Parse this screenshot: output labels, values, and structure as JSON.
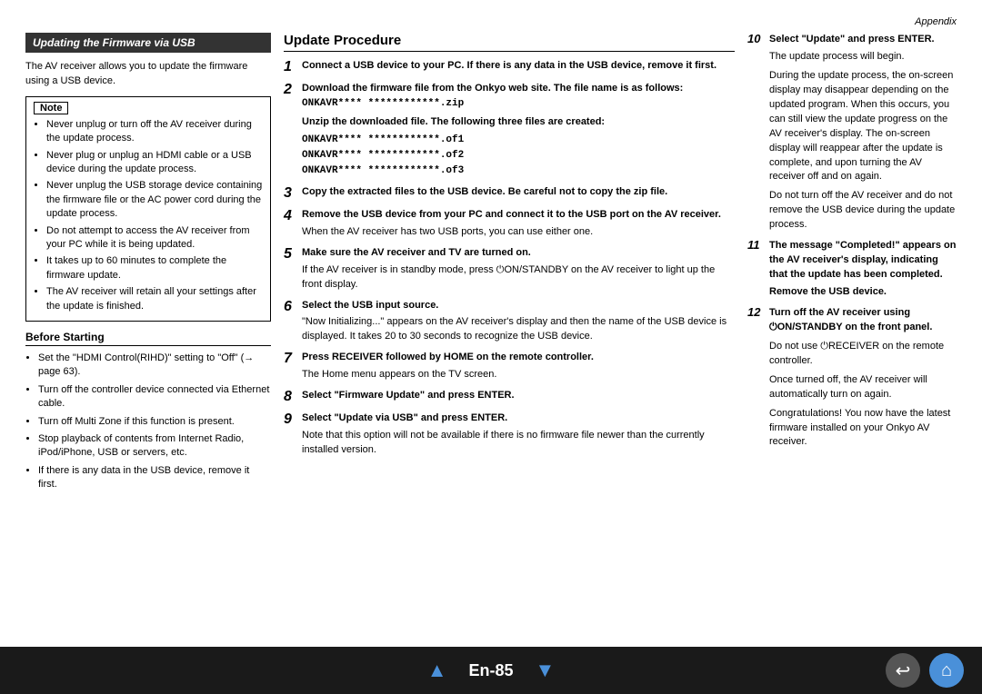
{
  "page": {
    "appendix_label": "Appendix",
    "page_number": "En-85"
  },
  "left_section": {
    "title": "Updating the Firmware via USB",
    "intro": "The AV receiver allows you to update the firmware using a USB device.",
    "note": {
      "label": "Note",
      "items": [
        "Never unplug or turn off the AV receiver during the update process.",
        "Never plug or unplug an HDMI cable or a USB device during the update process.",
        "Never unplug the USB storage device containing the firmware file or the AC power cord during the update process.",
        "Do not attempt to access the AV receiver from your PC while it is being updated.",
        "It takes up to 60 minutes to complete the firmware update.",
        "The AV receiver will retain all your settings after the update is finished."
      ]
    },
    "before_starting": {
      "title": "Before Starting",
      "items": [
        "Set the \"HDMI Control(RIHD)\" setting to \"Off\" (→ page 63).",
        "Turn off the controller device connected via Ethernet cable.",
        "Turn off Multi Zone if this function is present.",
        "Stop playback of contents from Internet Radio, iPod/iPhone, USB or servers, etc.",
        "If there is any data in the USB device, remove it first."
      ]
    }
  },
  "update_procedure": {
    "title": "Update Procedure",
    "steps": [
      {
        "num": "1",
        "bold": "Connect a USB device to your PC. If there is any data in the USB device, remove it first."
      },
      {
        "num": "2",
        "bold": "Download the firmware file from the Onkyo web site. The file name is as follows:",
        "code_main": "ONKAVR**** ************.zip",
        "sub_bold": "Unzip the downloaded file. The following three files are created:",
        "code_lines": [
          "ONKAVR**** ************.of1",
          "ONKAVR**** ************.of2",
          "ONKAVR**** ************.of3"
        ]
      },
      {
        "num": "3",
        "bold": "Copy the extracted files to the USB device. Be careful not to copy the zip file."
      },
      {
        "num": "4",
        "bold": "Remove the USB device from your PC and connect it to the USB port on the AV receiver.",
        "sub": "When the AV receiver has two USB ports, you can use either one."
      },
      {
        "num": "5",
        "bold": "Make sure the AV receiver and TV are turned on.",
        "sub": "If the AV receiver is in standby mode, press ⏻ON/STANDBY on the AV receiver to light up the front display."
      },
      {
        "num": "6",
        "bold": "Select the USB input source.",
        "sub": "\"Now Initializing...\" appears on the AV receiver's display and then the name of the USB device is displayed. It takes 20 to 30 seconds to recognize the USB device."
      },
      {
        "num": "7",
        "bold": "Press RECEIVER followed by HOME on the remote controller.",
        "sub": "The Home menu appears on the TV screen."
      },
      {
        "num": "8",
        "bold": "Select \"Firmware Update\" and press ENTER."
      },
      {
        "num": "9",
        "bold": "Select \"Update via USB\" and press ENTER.",
        "sub": "Note that this option will not be available if there is no firmware file newer than the currently installed version."
      }
    ]
  },
  "right_section": {
    "steps": [
      {
        "num": "10",
        "bold": "Select \"Update\" and press ENTER.",
        "sub": "The update process will begin.",
        "detail": "During the update process, the on-screen display may disappear depending on the updated program. When this occurs, you can still view the update progress on the AV receiver's display. The on-screen display will reappear after the update is complete, and upon turning the AV receiver off and on again.",
        "detail2": "Do not turn off the AV receiver and do not remove the USB device during the update process."
      },
      {
        "num": "11",
        "bold": "The message \"Completed!\" appears on the AV receiver's display, indicating that the update has been completed.",
        "bold2": "Remove the USB device."
      },
      {
        "num": "12",
        "bold": "Turn off the AV receiver using ⏻ON/STANDBY on the front panel.",
        "sub": "Do not use ⏻RECEIVER on the remote controller.",
        "sub2": "Once turned off, the AV receiver will automatically turn on again.",
        "sub3": "Congratulations! You now have the latest firmware installed on your Onkyo AV receiver."
      }
    ]
  },
  "footer": {
    "page_label": "En-85",
    "back_icon": "↩",
    "home_icon": "⌂",
    "arrow_up": "▲",
    "arrow_down": "▼"
  }
}
